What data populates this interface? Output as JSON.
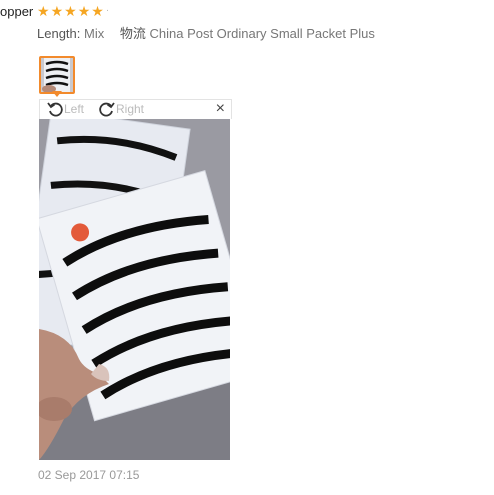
{
  "review": {
    "reviewer": "opper",
    "rating": 5,
    "attributes": {
      "length_label": "Length:",
      "length_value": "Mix",
      "logistics_label": "物流",
      "logistics_value": "China Post Ordinary Small Packet Plus"
    },
    "date": "02 Sep 2017 07:15"
  },
  "viewer": {
    "rotate_left_label": "Left",
    "rotate_right_label": "Right",
    "close_glyph": "×"
  },
  "icons": {
    "star": "star-icon",
    "rotate_left": "rotate-left-icon",
    "rotate_right": "rotate-right-icon",
    "close": "close-icon"
  },
  "colors": {
    "star": "#f5a623",
    "thumb_border": "#f28a2c",
    "muted_text": "#999999"
  }
}
